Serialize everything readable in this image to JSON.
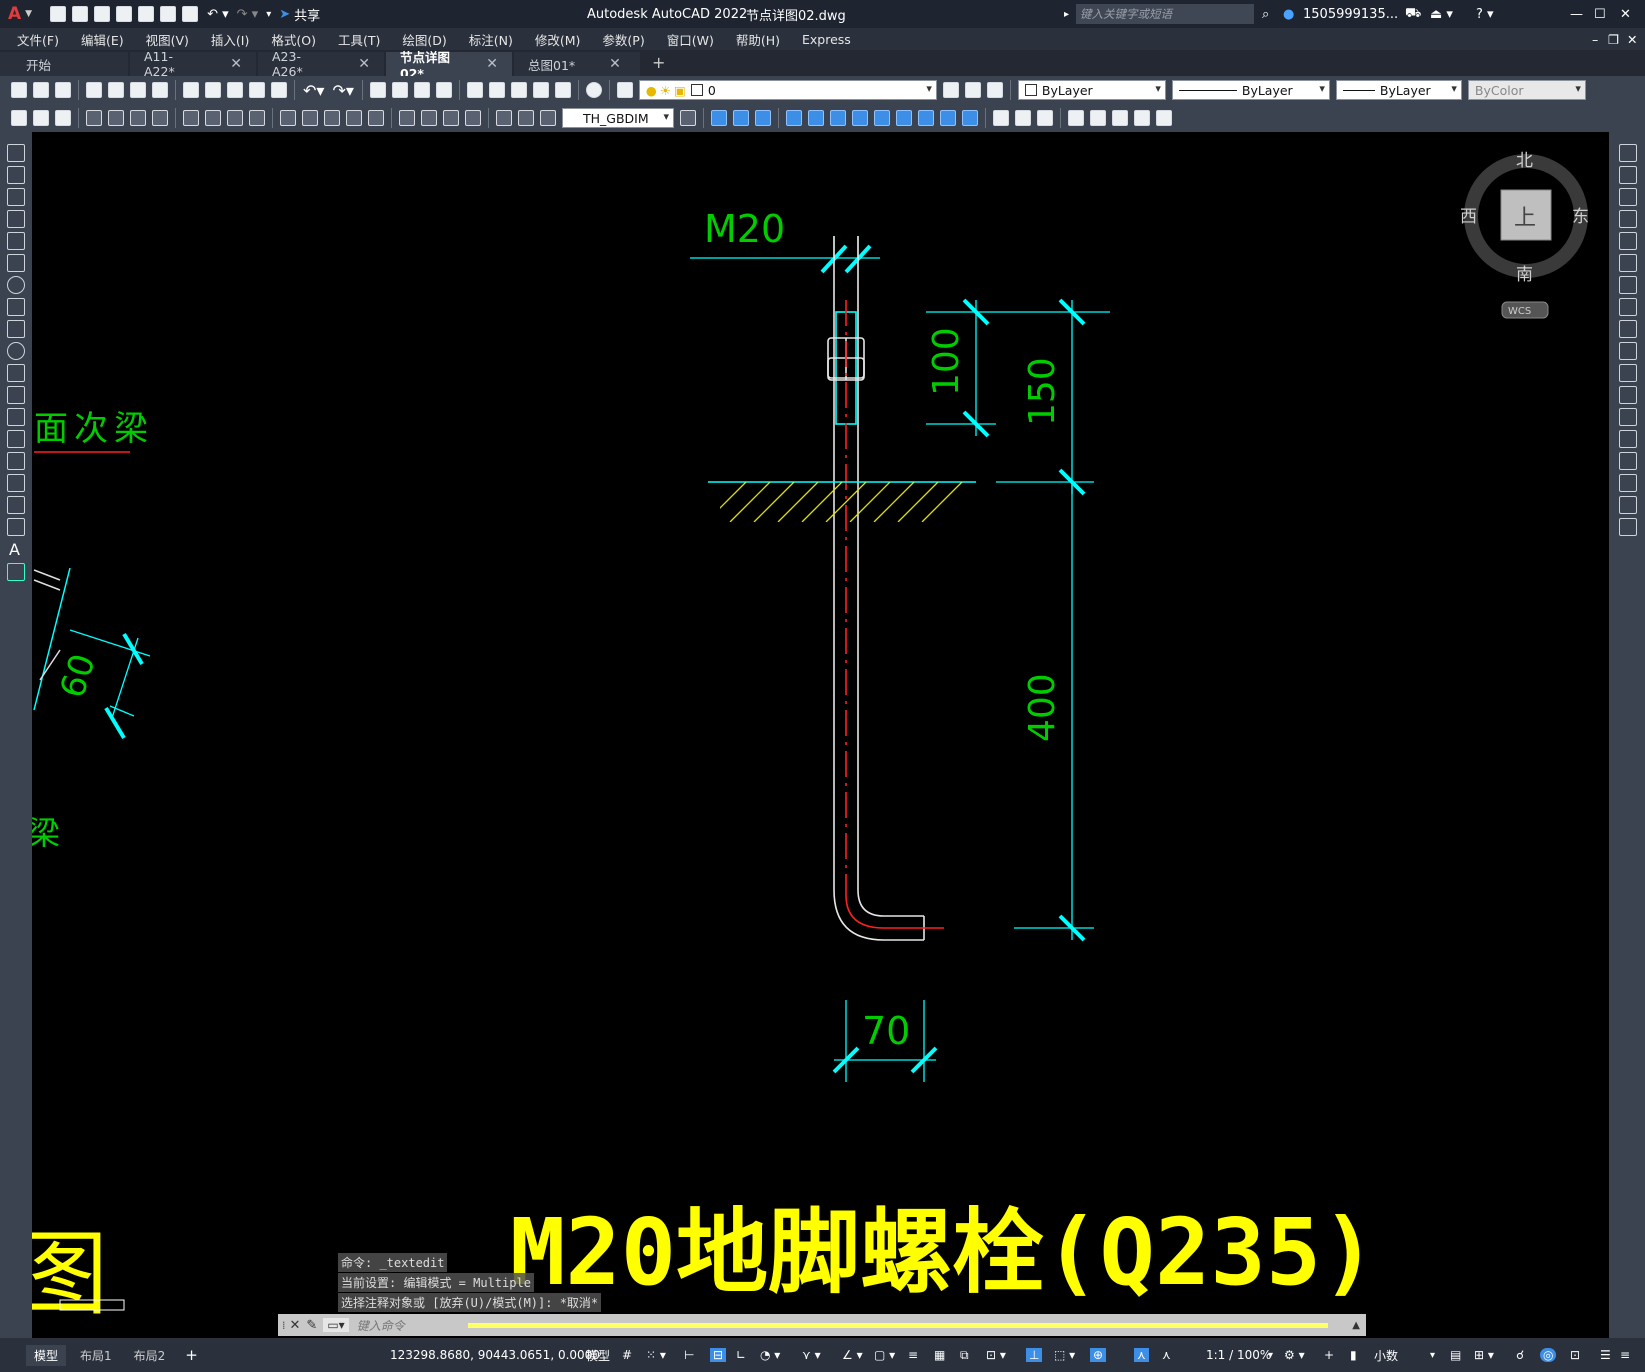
{
  "title_bar": {
    "app_title": "Autodesk AutoCAD 2022",
    "file_name": "节点详图02.dwg",
    "share_label": "共享",
    "search_placeholder": "键入关键字或短语",
    "user_name": "1505999135..."
  },
  "menu": [
    "文件(F)",
    "编辑(E)",
    "视图(V)",
    "插入(I)",
    "格式(O)",
    "工具(T)",
    "绘图(D)",
    "标注(N)",
    "修改(M)",
    "参数(P)",
    "窗口(W)",
    "帮助(H)",
    "Express"
  ],
  "tabs": [
    {
      "label": "开始"
    },
    {
      "label": "A11-A22*"
    },
    {
      "label": "A23-A26*"
    },
    {
      "label": "节点详图02*"
    },
    {
      "label": "总图01*"
    }
  ],
  "toolbar": {
    "layer_value": "0",
    "color_value": "ByLayer",
    "linetype_value": "ByLayer",
    "lineweight_value": "ByLayer",
    "plotstyle_value": "ByColor",
    "dimstyle_value": "TH_GBDIM"
  },
  "viewcube": {
    "north": "北",
    "south": "南",
    "east": "东",
    "west": "西",
    "top": "上",
    "wcs": "WCS"
  },
  "drawing": {
    "bolt_label": "M20",
    "dim_100": "100",
    "dim_150": "150",
    "dim_400": "400",
    "dim_70": "70",
    "dim_60": "60",
    "left_label_1": "面次梁",
    "left_label_2": "梁",
    "left_label_3": "图"
  },
  "caption": "M20地脚螺栓(Q235)",
  "command_history": [
    "命令: _textedit",
    "当前设置: 编辑模式 = Multiple",
    "选择注释对象或 [放弃(U)/模式(M)]: *取消*"
  ],
  "command_input_placeholder": "键入命令",
  "layout_tabs": [
    "模型",
    "布局1",
    "布局2"
  ],
  "status": {
    "coordinates": "123298.8680, 90443.0651, 0.0000",
    "mode": "模型",
    "scale": "1:1 / 100%",
    "units": "小数"
  },
  "colors": {
    "dim_cyan": "#00ffff",
    "text_green": "#00cc00",
    "hatch_yellow": "#e6e600",
    "caption_yellow": "#ffff00",
    "center_red": "#ff2020"
  }
}
